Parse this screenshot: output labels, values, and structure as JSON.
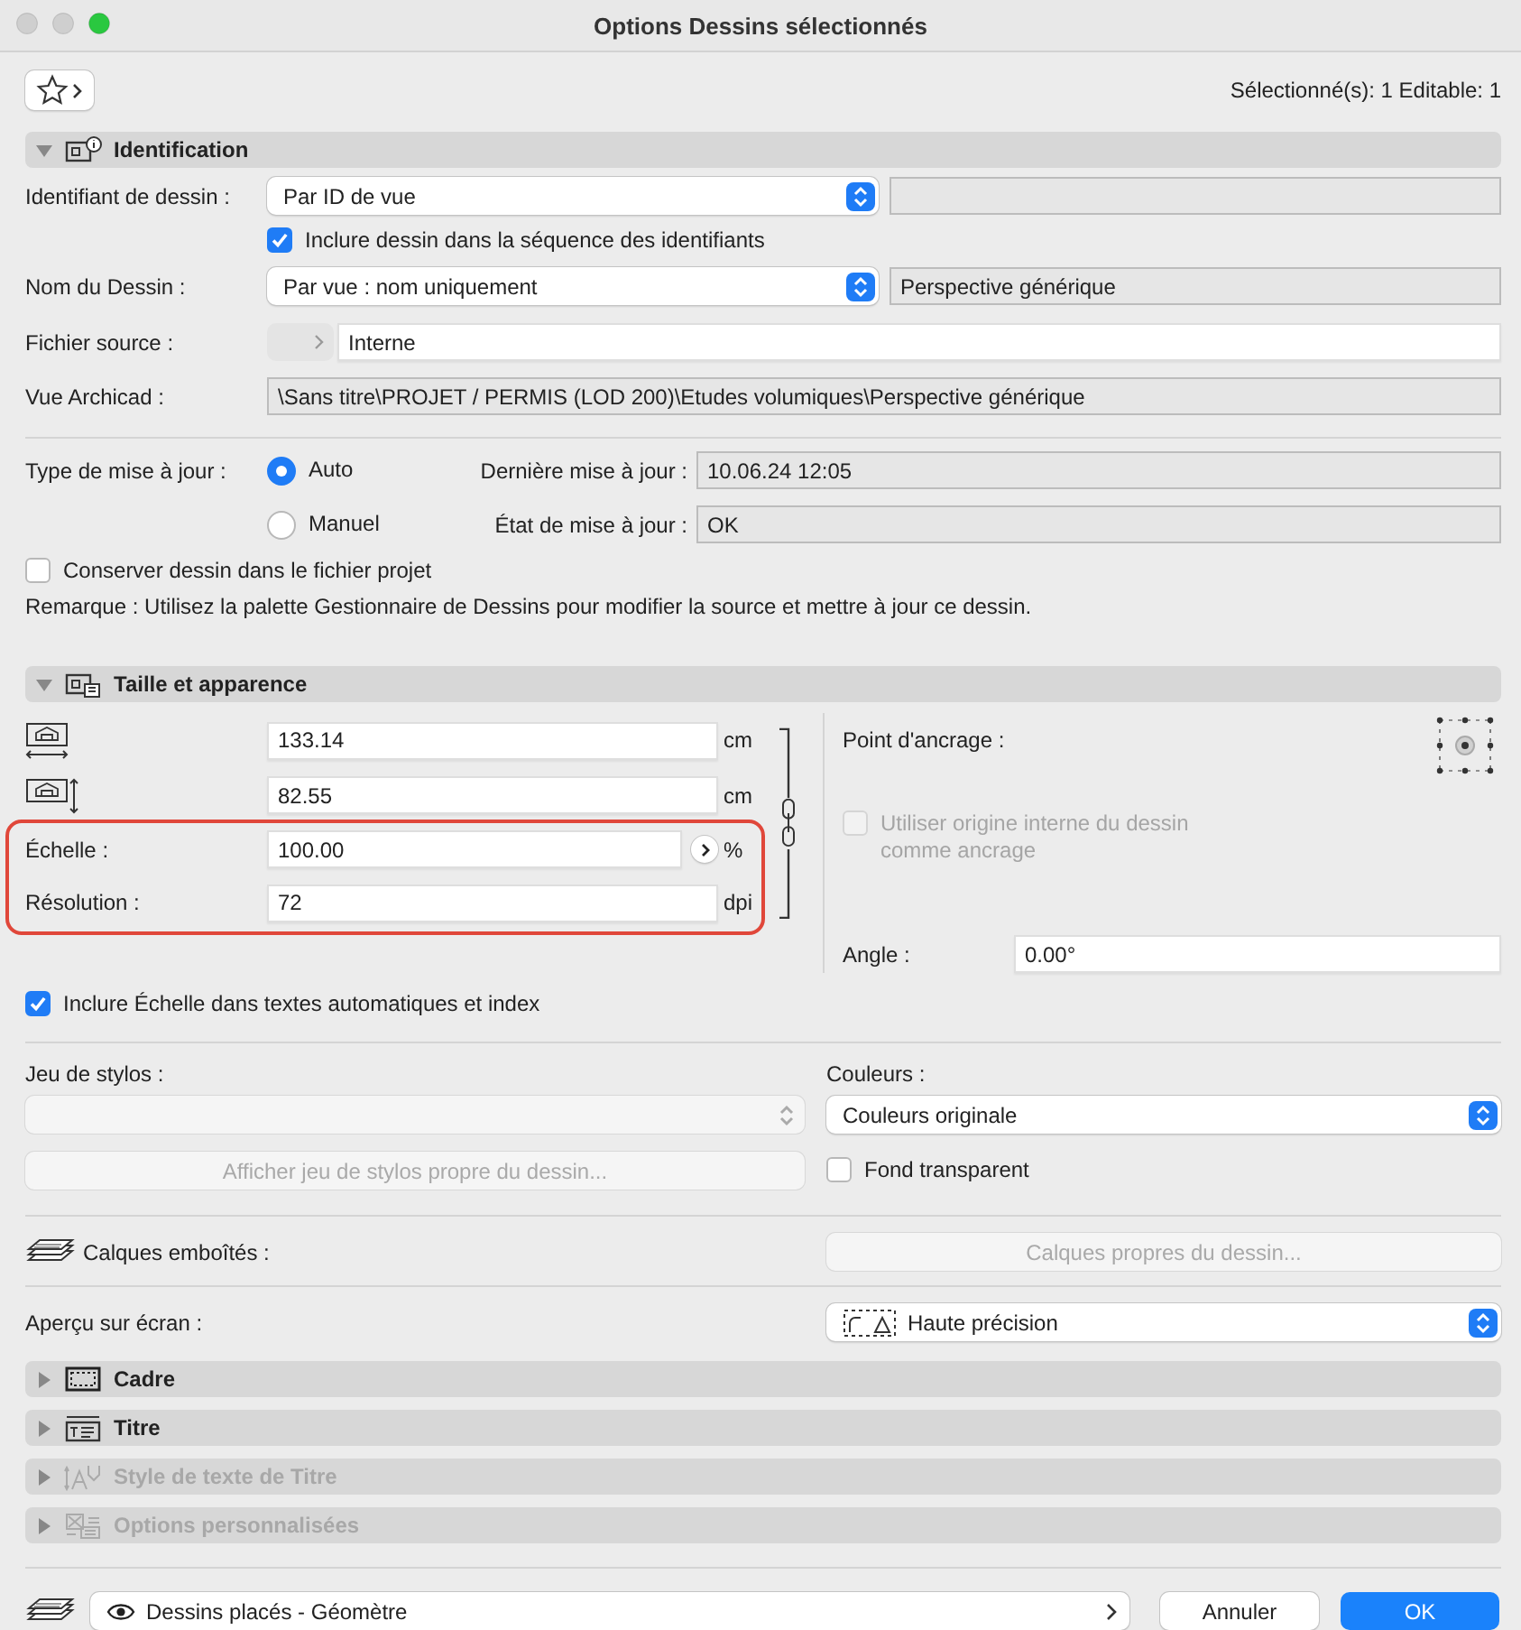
{
  "window": {
    "title": "Options Dessins sélectionnés"
  },
  "toolbar": {
    "selection_info": "Sélectionné(s): 1 Editable: 1"
  },
  "identification": {
    "title": "Identification",
    "kind": "identification",
    "expanded": true,
    "drawing_id": {
      "label": "Identifiant de dessin :",
      "popup": "Par ID de vue"
    },
    "include_in_sequence": {
      "label": "Inclure dessin dans la séquence des identifiants",
      "checked": true
    },
    "drawing_name": {
      "label": "Nom du Dessin :",
      "popup": "Par vue : nom uniquement",
      "value": "Perspective générique"
    },
    "source_file": {
      "label": "Fichier source :",
      "value": "Interne"
    },
    "archicad_view": {
      "label": "Vue Archicad :",
      "value": "\\Sans titre\\PROJET / PERMIS (LOD 200)\\Etudes volumiques\\Perspective générique"
    },
    "update_type": {
      "label": "Type de mise à jour :",
      "options": [
        {
          "label": "Auto",
          "selected": true
        },
        {
          "label": "Manuel",
          "selected": false
        }
      ]
    },
    "last_update": {
      "label": "Dernière mise à jour :",
      "value": "10.06.24 12:05"
    },
    "update_state": {
      "label": "État de mise à jour :",
      "value": "OK"
    },
    "keep_in_project": {
      "label": "Conserver dessin dans le fichier projet",
      "checked": false
    },
    "remark": "Remarque : Utilisez la palette Gestionnaire de Dessins pour modifier la source et mettre à jour ce dessin."
  },
  "size_appearance": {
    "title": "Taille et apparence",
    "kind": "size",
    "expanded": true,
    "width": {
      "value": "133.14",
      "unit": "cm"
    },
    "height": {
      "value": "82.55",
      "unit": "cm"
    },
    "scale": {
      "label": "Échelle :",
      "value": "100.00",
      "unit": "%",
      "highlighted": true
    },
    "resolution": {
      "label": "Résolution :",
      "value": "72",
      "unit": "dpi",
      "highlighted": true
    },
    "anchor_point": {
      "label": "Point d'ancrage :"
    },
    "use_internal_origin": {
      "label": "Utiliser origine interne du dessin comme ancrage",
      "checked": false,
      "disabled": true
    },
    "angle": {
      "label": "Angle :",
      "value": "0.00°"
    },
    "include_scale": {
      "label": "Inclure Échelle dans textes automatiques et index",
      "checked": true
    },
    "pen_set": {
      "label": "Jeu de stylos :",
      "disabled": true
    },
    "pen_set_button": {
      "label": "Afficher jeu de stylos propre du dessin...",
      "disabled": true
    },
    "colors": {
      "label": "Couleurs :",
      "popup": "Couleurs originale"
    },
    "transparent_background": {
      "label": "Fond transparent",
      "checked": false
    },
    "nested_layers": {
      "label": "Calques emboîtés :"
    },
    "layers_button": {
      "label": "Calques propres du dessin...",
      "disabled": true
    },
    "screen_preview": {
      "label": "Aperçu sur écran :",
      "popup": "Haute précision"
    }
  },
  "other_sections": [
    {
      "title": "Cadre",
      "kind": "frame",
      "expanded": false,
      "disabled": false
    },
    {
      "title": "Titre",
      "kind": "title",
      "expanded": false,
      "disabled": false
    },
    {
      "title": "Style de texte de Titre",
      "kind": "text_style",
      "expanded": false,
      "disabled": true
    },
    {
      "title": "Options personnalisées",
      "kind": "custom",
      "expanded": false,
      "disabled": true
    }
  ],
  "footer": {
    "favorites": "Dessins placés - Géomètre",
    "buttons": [
      {
        "label": "Annuler",
        "kind": "secondary"
      },
      {
        "label": "OK",
        "kind": "primary"
      }
    ]
  }
}
